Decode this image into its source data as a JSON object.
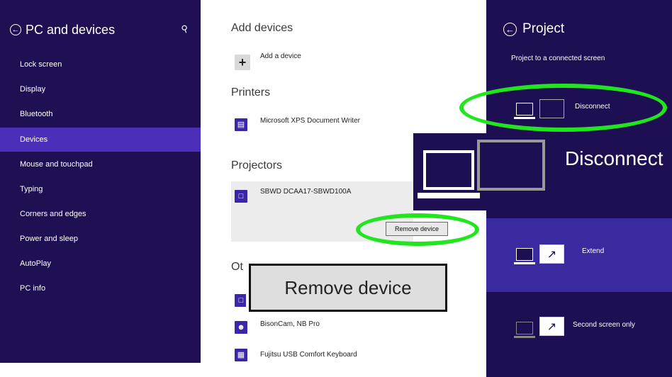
{
  "sidebar": {
    "title": "PC and devices",
    "items": [
      {
        "label": "Lock screen"
      },
      {
        "label": "Display"
      },
      {
        "label": "Bluetooth"
      },
      {
        "label": "Devices",
        "selected": true
      },
      {
        "label": "Mouse and touchpad"
      },
      {
        "label": "Typing"
      },
      {
        "label": "Corners and edges"
      },
      {
        "label": "Power and sleep"
      },
      {
        "label": "AutoPlay"
      },
      {
        "label": "PC info"
      }
    ]
  },
  "devices": {
    "add_title": "Add devices",
    "add_label": "Add a device",
    "printers_title": "Printers",
    "printer_name": "Microsoft XPS Document Writer",
    "projectors_title": "Projectors",
    "projector_name": "SBWD DCAA17-SBWD100A",
    "remove_button": "Remove device",
    "other_title_partial": "Ot",
    "other_items": [
      {
        "label": "BisonCam, NB Pro"
      },
      {
        "label": "Fujitsu USB Comfort Keyboard"
      }
    ]
  },
  "zoom": {
    "remove_label": "Remove device",
    "disconnect_label": "Disconnect"
  },
  "project": {
    "title": "Project",
    "subtitle": "Project to a connected screen",
    "options": [
      {
        "label": "Disconnect"
      },
      {
        "label": "Extend",
        "selected": true
      },
      {
        "label": "Second screen only"
      }
    ]
  },
  "colors": {
    "sidebar_bg": "#200f53",
    "selected_bg": "#4c2fb8",
    "project_bg": "#1e0f52",
    "highlight_ring": "#21e51f"
  }
}
